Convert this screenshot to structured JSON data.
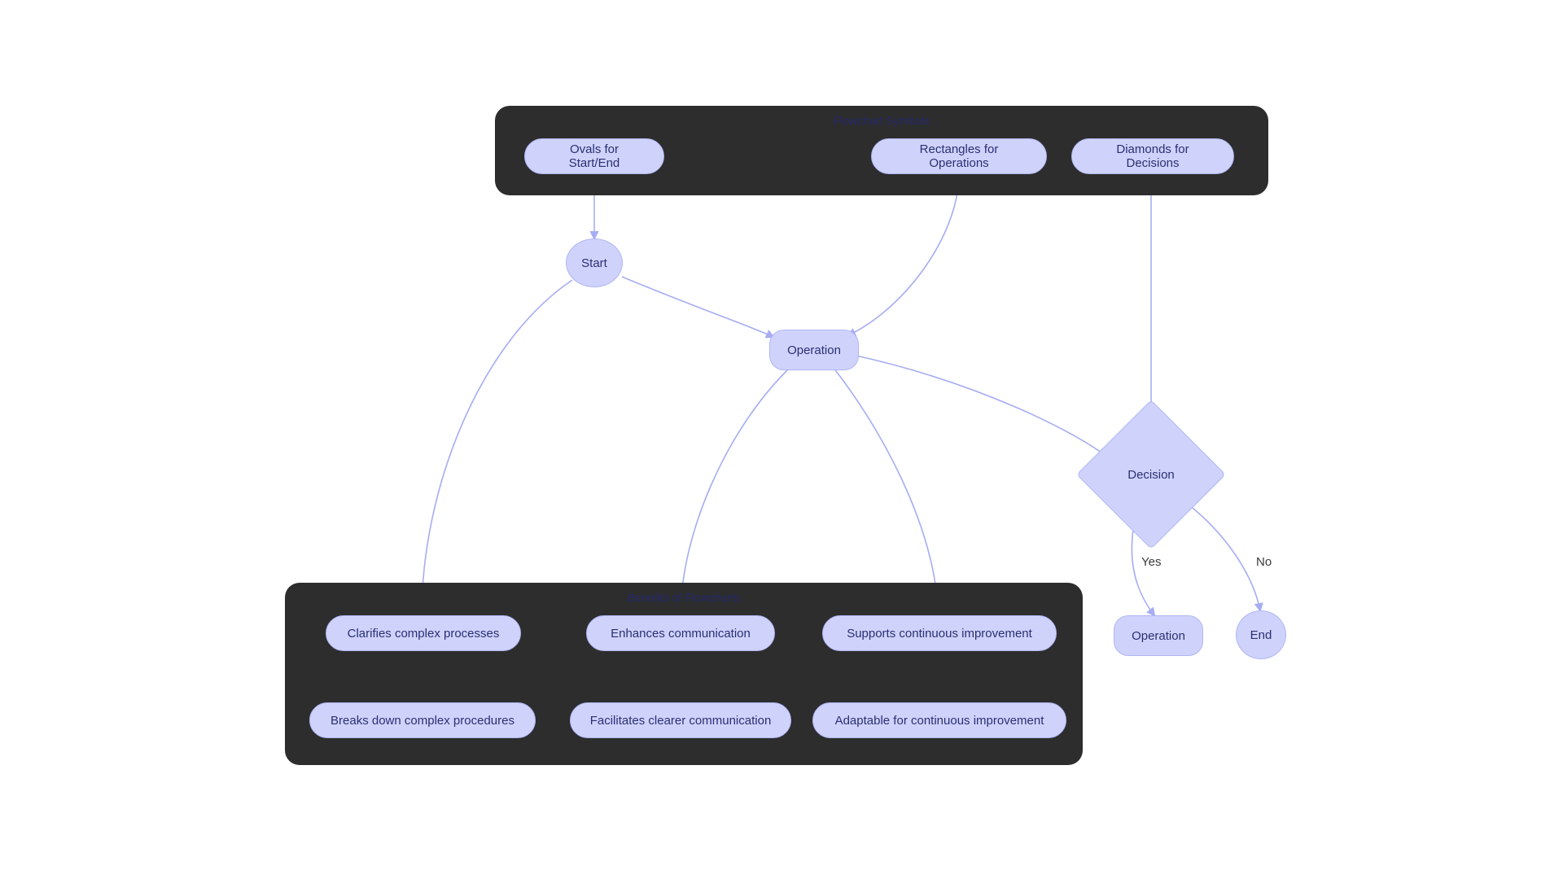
{
  "groups": {
    "symbols": {
      "title": "Flowchart Symbols",
      "nodes": {
        "ovals": "Ovals for Start/End",
        "rects": "Rectangles for Operations",
        "diamonds": "Diamonds for Decisions"
      }
    },
    "benefits": {
      "title": "Benefits of Flowcharts",
      "row1": {
        "a": "Clarifies complex processes",
        "b": "Enhances communication",
        "c": "Supports continuous improvement"
      },
      "row2": {
        "a": "Breaks down complex procedures",
        "b": "Facilitates clearer communication",
        "c": "Adaptable for continuous improvement"
      }
    }
  },
  "flow": {
    "start": "Start",
    "operation": "Operation",
    "decision": "Decision",
    "operation2": "Operation",
    "end": "End"
  },
  "edges": {
    "yes": "Yes",
    "no": "No"
  },
  "colors": {
    "node_fill": "#cfd3fb",
    "node_text": "#2a2f74",
    "group_bg": "#2d2d2d",
    "arrow": "#a6adf2"
  }
}
